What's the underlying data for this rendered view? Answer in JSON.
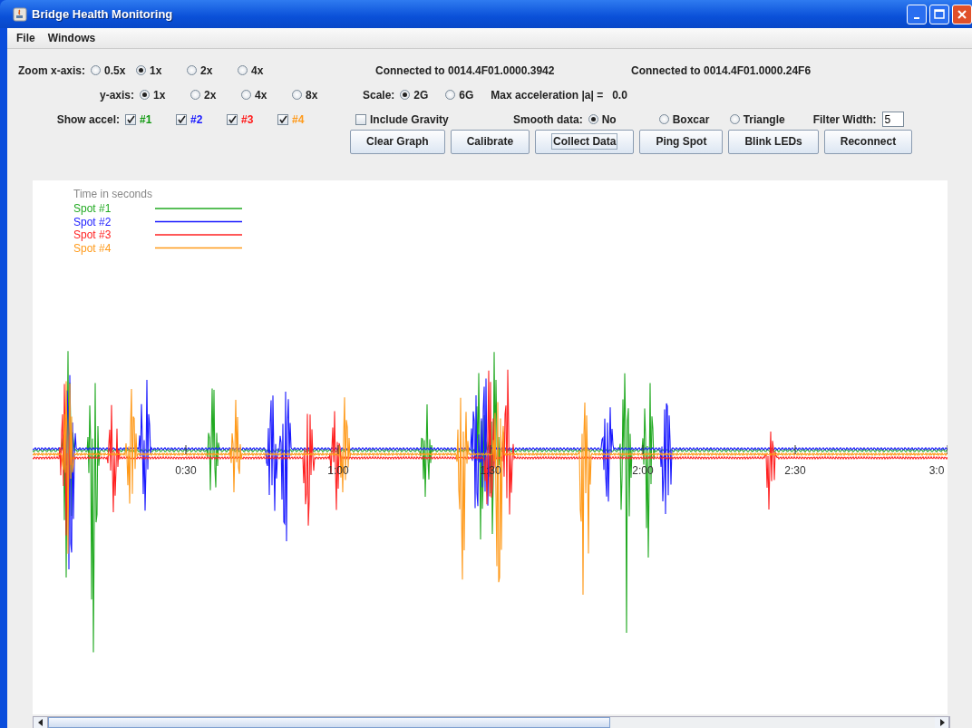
{
  "window": {
    "title": "Bridge Health Monitoring"
  },
  "menu": [
    {
      "label": "File"
    },
    {
      "label": "Windows"
    }
  ],
  "zoom_x": {
    "label": "Zoom x-axis:",
    "options": [
      {
        "label": "0.5x",
        "selected": false
      },
      {
        "label": "1x",
        "selected": true
      },
      {
        "label": "2x",
        "selected": false
      },
      {
        "label": "4x",
        "selected": false
      }
    ]
  },
  "y_axis": {
    "label": "y-axis:",
    "options": [
      {
        "label": "1x",
        "selected": true
      },
      {
        "label": "2x",
        "selected": false
      },
      {
        "label": "4x",
        "selected": false
      },
      {
        "label": "8x",
        "selected": false
      }
    ]
  },
  "show_accel": {
    "label": "Show accel:",
    "items": [
      {
        "label": "#1",
        "checked": true,
        "color": "#119911"
      },
      {
        "label": "#2",
        "checked": true,
        "color": "#1a1aff"
      },
      {
        "label": "#3",
        "checked": true,
        "color": "#ff1a1a"
      },
      {
        "label": "#4",
        "checked": true,
        "color": "#ff9a1a"
      }
    ]
  },
  "connections": [
    "Connected to 0014.4F01.0000.3942",
    "Connected to 0014.4F01.0000.24F6"
  ],
  "scale": {
    "label": "Scale:",
    "options": [
      {
        "label": "2G",
        "selected": true
      },
      {
        "label": "6G",
        "selected": false
      }
    ]
  },
  "max_acceleration": {
    "label": "Max acceleration |a| =",
    "value": "0.0"
  },
  "include_gravity": {
    "label": "Include Gravity",
    "checked": false
  },
  "smooth_data": {
    "label": "Smooth data:",
    "options": [
      {
        "label": "No",
        "selected": true
      },
      {
        "label": "Boxcar",
        "selected": false
      },
      {
        "label": "Triangle",
        "selected": false
      }
    ]
  },
  "filter_width": {
    "label": "Filter Width:",
    "value": "5"
  },
  "buttons": [
    {
      "label": "Clear Graph",
      "focused": false
    },
    {
      "label": "Calibrate",
      "focused": false
    },
    {
      "label": "Collect Data",
      "focused": true
    },
    {
      "label": "Ping Spot",
      "focused": false
    },
    {
      "label": "Blink LEDs",
      "focused": false
    },
    {
      "label": "Reconnect",
      "focused": false
    }
  ],
  "chart": {
    "axis_title": "Time in seconds",
    "legend": [
      {
        "label": "Spot #1",
        "color": "#22aa22"
      },
      {
        "label": "Spot #2",
        "color": "#1a1aff"
      },
      {
        "label": "Spot #3",
        "color": "#ff2222"
      },
      {
        "label": "Spot #4",
        "color": "#ff9a1a"
      }
    ],
    "time_ticks": [
      "0:30",
      "1:00",
      "1:30",
      "2:00",
      "2:30",
      "3:0"
    ]
  }
}
